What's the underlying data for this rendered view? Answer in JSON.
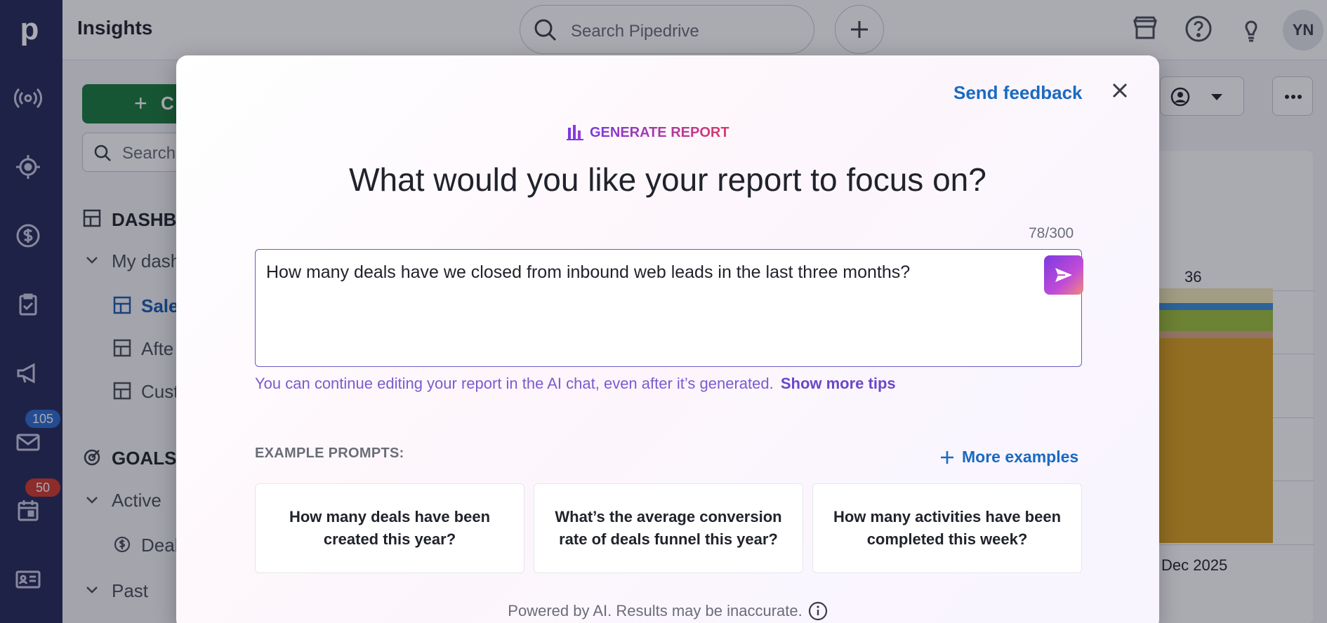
{
  "rail": {
    "logo": "p",
    "mail_badge": "105",
    "calendar_badge": "50",
    "icons": [
      "radio-icon",
      "target-icon",
      "dollar-icon",
      "clipboard-icon",
      "megaphone-icon",
      "mail-icon",
      "calendar-icon",
      "id-card-icon"
    ]
  },
  "topbar": {
    "title": "Insights",
    "search_placeholder": "Search Pipedrive",
    "avatar_initials": "YN"
  },
  "sidebar": {
    "create_label": "C",
    "search_placeholder": "Search",
    "dashboards_heading": "DASHB",
    "my_dashboards": "My dash",
    "item_sales": "Sale",
    "item_after": "Afte",
    "item_custom": "Cust",
    "goals_heading": "GOALS",
    "active": "Active",
    "item_deals": "Deal",
    "past": "Past"
  },
  "chart_bg": {
    "top_value": "36",
    "x_label": "Dec 2025"
  },
  "modal": {
    "feedback": "Send feedback",
    "badge": "GENERATE REPORT",
    "heading": "What would you like your report to focus on?",
    "counter": "78/300",
    "input_value": "How many deals have we closed from inbound web leads in the last three months?",
    "hint": "You can continue editing your report in the AI chat, even after it’s generated.",
    "tips_link": "Show more tips",
    "examples_label": "EXAMPLE PROMPTS:",
    "more_examples": "More examples",
    "examples": [
      "How many deals have been created this year?",
      "What’s the average conversion rate of deals funnel this year?",
      "How many activities have been completed this week?"
    ],
    "powered": "Powered by AI. Results may be inaccurate."
  },
  "colors": {
    "rail": "#26295a",
    "create_button": "#1a7a3c",
    "link": "#1a6ac0",
    "accent_purple": "#7b3ae0"
  }
}
